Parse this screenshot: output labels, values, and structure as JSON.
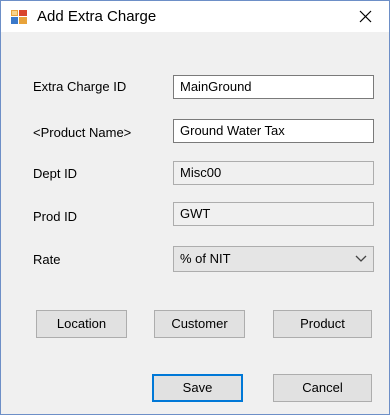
{
  "window": {
    "title": "Add Extra Charge",
    "icon": "form-window-icon",
    "close_icon": "close-icon"
  },
  "form": {
    "extra_charge_id": {
      "label": "Extra Charge ID",
      "value": "MainGround"
    },
    "product_name": {
      "label": "<Product Name>",
      "value": "Ground Water Tax"
    },
    "dept_id": {
      "label": "Dept ID",
      "value": "Misc00"
    },
    "prod_id": {
      "label": "Prod ID",
      "value": "GWT"
    },
    "rate": {
      "label": "Rate",
      "selected": "% of NIT"
    }
  },
  "buttons": {
    "location": "Location",
    "customer": "Customer",
    "product": "Product",
    "save": "Save",
    "cancel": "Cancel"
  },
  "colors": {
    "window_border": "#6d8fc7",
    "dialog_bg": "#f0f0f0",
    "button_bg": "#e1e1e1",
    "default_button_border": "#0078d7"
  }
}
